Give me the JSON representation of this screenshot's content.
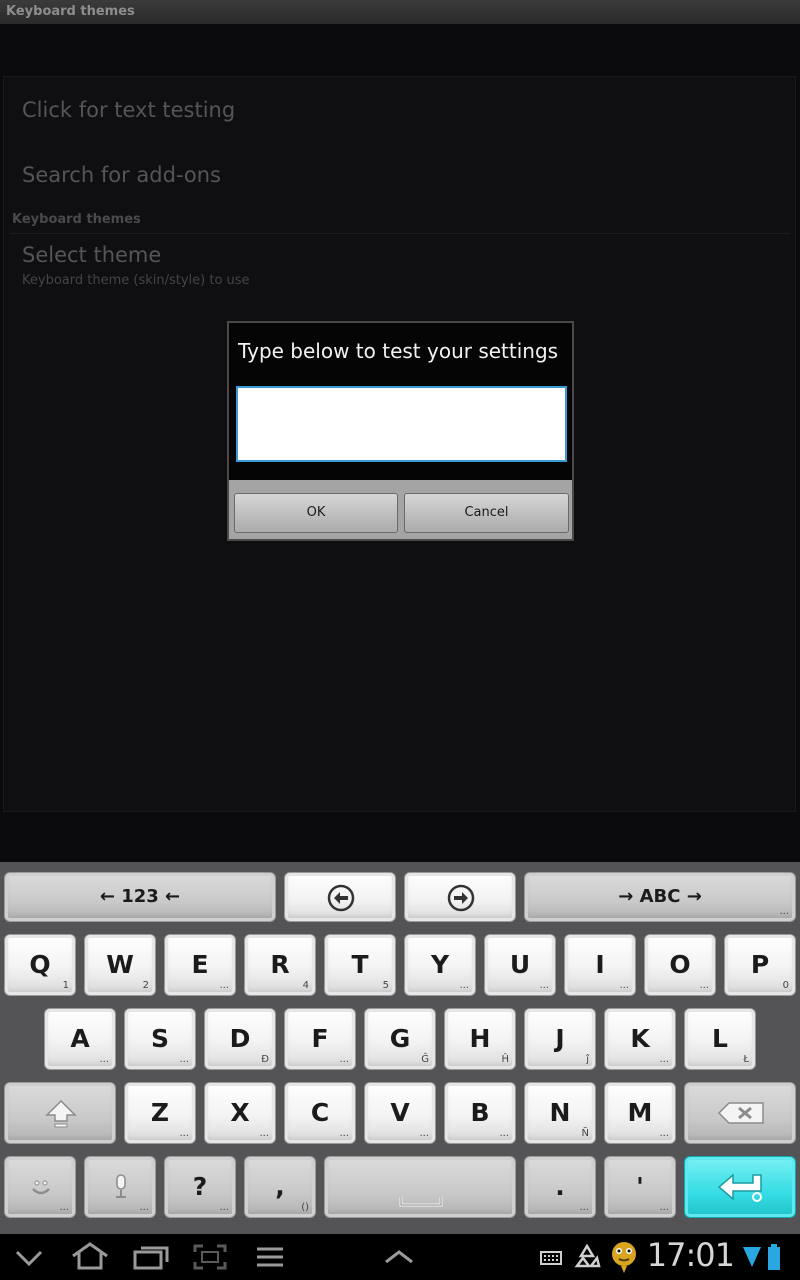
{
  "window": {
    "title": "Keyboard themes"
  },
  "preferences": {
    "item1": "Click for text testing",
    "item2": "Search for add-ons",
    "category": "Keyboard themes",
    "theme_title": "Select theme",
    "theme_summary": "Keyboard theme (skin/style) to use"
  },
  "dialog": {
    "title": "Type below to test your settings",
    "input_value": "",
    "ok_label": "OK",
    "cancel_label": "Cancel"
  },
  "keyboard": {
    "top_row": {
      "left": "← 123 ←",
      "right": "→ ABC →",
      "ellipsis": "..."
    },
    "row1": [
      {
        "k": "Q",
        "s": "1"
      },
      {
        "k": "W",
        "s": "2"
      },
      {
        "k": "E",
        "s": "..."
      },
      {
        "k": "R",
        "s": "4"
      },
      {
        "k": "T",
        "s": "5"
      },
      {
        "k": "Y",
        "s": "..."
      },
      {
        "k": "U",
        "s": "..."
      },
      {
        "k": "I",
        "s": "..."
      },
      {
        "k": "O",
        "s": "..."
      },
      {
        "k": "P",
        "s": "0"
      }
    ],
    "row2": [
      {
        "k": "A",
        "s": "..."
      },
      {
        "k": "S",
        "s": "..."
      },
      {
        "k": "D",
        "s": "Đ"
      },
      {
        "k": "F",
        "s": "..."
      },
      {
        "k": "G",
        "s": "Ĝ"
      },
      {
        "k": "H",
        "s": "Ĥ"
      },
      {
        "k": "J",
        "s": "ĵ"
      },
      {
        "k": "K",
        "s": "..."
      },
      {
        "k": "L",
        "s": "Ł"
      }
    ],
    "row3": [
      {
        "k": "Z",
        "s": "..."
      },
      {
        "k": "X",
        "s": "..."
      },
      {
        "k": "C",
        "s": "..."
      },
      {
        "k": "V",
        "s": "..."
      },
      {
        "k": "B",
        "s": "..."
      },
      {
        "k": "N",
        "s": "Ñ"
      },
      {
        "k": "M",
        "s": "..."
      }
    ],
    "row4": {
      "question": "?",
      "question_sub": "...",
      "comma": ",",
      "comma_sub": "()",
      "period": ".",
      "period_sub": "...",
      "apostrophe": "'",
      "apostrophe_sub": "...",
      "smiley_sub": "...",
      "mic_sub": "..."
    }
  },
  "status": {
    "time": "17:01"
  },
  "colors": {
    "enter_key": "#35dde4",
    "input_focus": "#3a9ad8"
  }
}
